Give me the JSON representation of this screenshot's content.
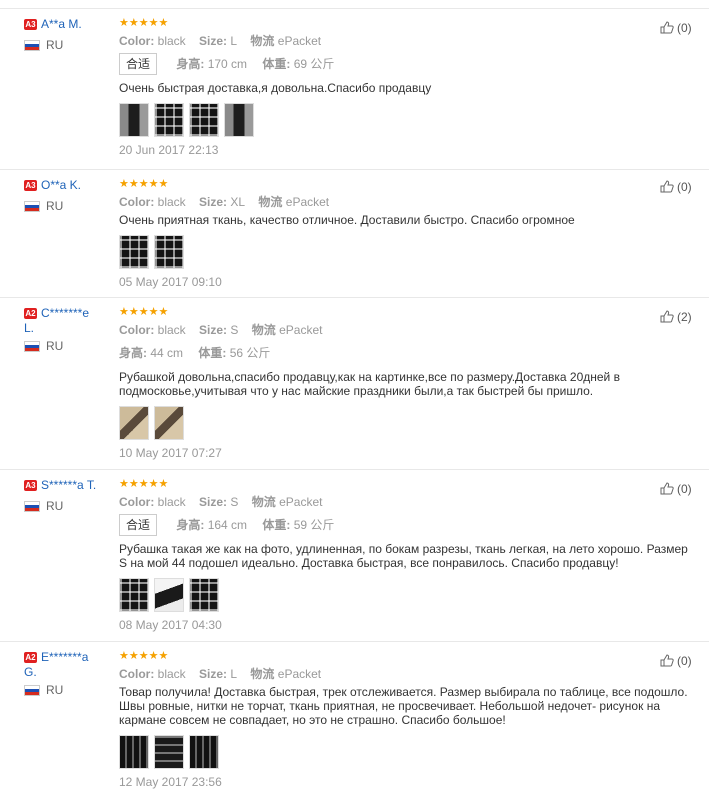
{
  "reviews": [
    {
      "badge": "A3",
      "name": "A**a M.",
      "country": "RU",
      "stars": "★★★★★",
      "color_label": "Color:",
      "color": "black",
      "size_label": "Size:",
      "size": "L",
      "ship_label": "物流",
      "ship": "ePacket",
      "fit": "合适",
      "height_label": "身高:",
      "height": "170 cm",
      "weight_label": "体重:",
      "weight": "69 公斤",
      "text": "Очень быстрая доставка,я довольна.Спасибо продавцу",
      "date": "20 Jun 2017 22:13",
      "likes": "(0)"
    },
    {
      "badge": "A3",
      "name": "O**a K.",
      "country": "RU",
      "stars": "★★★★★",
      "color_label": "Color:",
      "color": "black",
      "size_label": "Size:",
      "size": "XL",
      "ship_label": "物流",
      "ship": "ePacket",
      "text": "Очень приятная ткань, качество отличное. Доставили быстро. Спасибо огромное",
      "date": "05 May 2017 09:10",
      "likes": "(0)"
    },
    {
      "badge": "A2",
      "name": "C*******e",
      "name2": "L.",
      "country": "RU",
      "stars": "★★★★★",
      "color_label": "Color:",
      "color": "black",
      "size_label": "Size:",
      "size": "S",
      "ship_label": "物流",
      "ship": "ePacket",
      "height_label": "身高:",
      "height": "44 cm",
      "weight_label": "体重:",
      "weight": "56 公斤",
      "text": "Рубашкой довольна,спасибо продавцу,как на картинке,все по размеру.Доставка 20дней в подмосковье,учитывая что у нас майские праздники были,а так быстрей бы пришло.",
      "date": "10 May 2017 07:27",
      "likes": "(2)"
    },
    {
      "badge": "A3",
      "name": "S******a T.",
      "country": "RU",
      "stars": "★★★★★",
      "color_label": "Color:",
      "color": "black",
      "size_label": "Size:",
      "size": "S",
      "ship_label": "物流",
      "ship": "ePacket",
      "fit": "合适",
      "height_label": "身高:",
      "height": "164 cm",
      "weight_label": "体重:",
      "weight": "59 公斤",
      "text": "Рубашка такая же как на фото, удлиненная, по бокам разрезы, ткань легкая, на лето хорошо. Размер S на мой 44 подошел идеально. Доставка быстрая, все понравилось. Спасибо продавцу!",
      "date": "08 May 2017 04:30",
      "likes": "(0)"
    },
    {
      "badge": "A2",
      "name": "E*******a",
      "name2": "G.",
      "country": "RU",
      "stars": "★★★★★",
      "color_label": "Color:",
      "color": "black",
      "size_label": "Size:",
      "size": "L",
      "ship_label": "物流",
      "ship": "ePacket",
      "text": "Товар получила! Доставка быстрая, трек отслеживается. Размер выбирала по таблице, все подошло. Швы ровные, нитки не торчат, ткань приятная, не просвечивает. Небольшой недочет- рисунок на кармане совсем не совпадает, но это не страшно. Спасибо большое!",
      "date": "12 May 2017 23:56",
      "likes": "(0)"
    }
  ],
  "colors": {
    "accent_link": "#1f63b8",
    "star": "#f5a100",
    "badge": "#e02020",
    "muted": "#999999"
  }
}
